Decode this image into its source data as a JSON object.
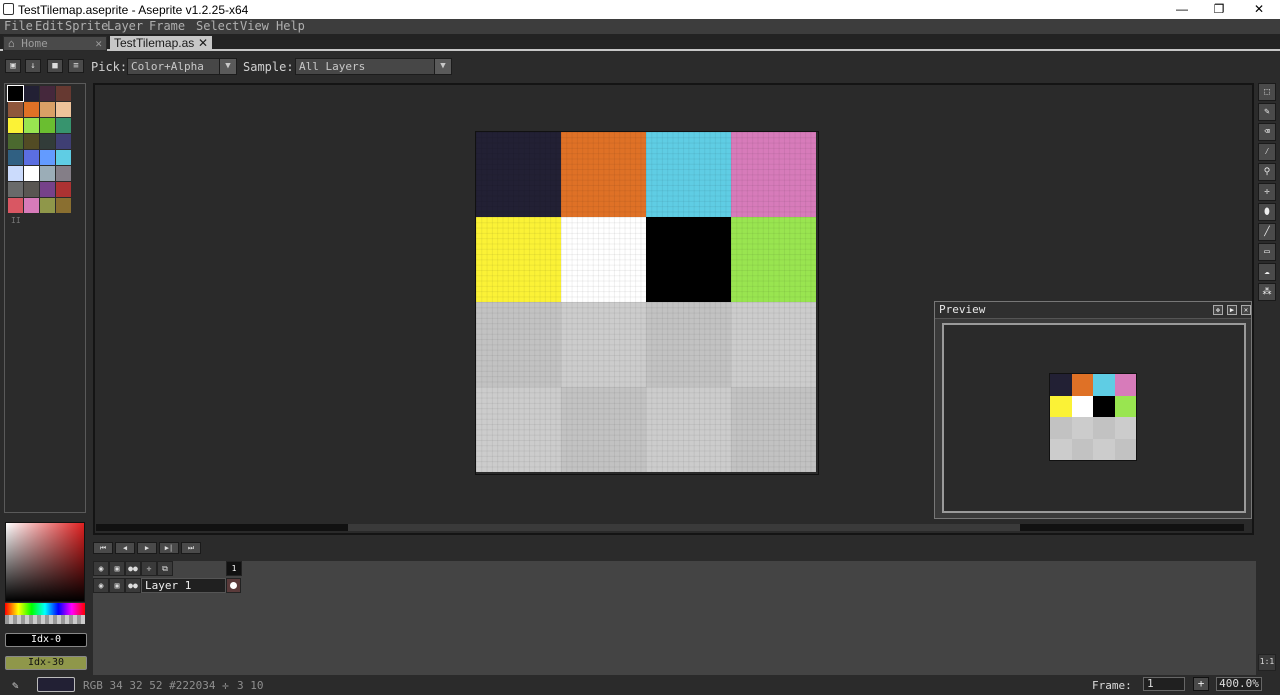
{
  "window": {
    "title": "TestTilemap.aseprite - Aseprite v1.2.25-x64",
    "min": "—",
    "max": "❐",
    "close": "✕"
  },
  "menu": [
    "File",
    "Edit",
    "Sprite",
    "Layer",
    "Frame",
    "Select",
    "View",
    "Help"
  ],
  "tabs": [
    {
      "label": "Home",
      "icon": "home-icon",
      "close": "✕"
    },
    {
      "label": "TestTilemap.as",
      "close": "✕"
    }
  ],
  "toolbar": {
    "pick_label": "Pick:",
    "pick_value": "Color+Alpha",
    "sample_label": "Sample:",
    "sample_value": "All Layers"
  },
  "palette": {
    "colors": [
      "#000000",
      "#222034",
      "#45283c",
      "#663931",
      "#8f563b",
      "#df7126",
      "#d9a066",
      "#eec39a",
      "#fbf236",
      "#99e550",
      "#6abe30",
      "#37946e",
      "#4b692f",
      "#524b24",
      "#323c39",
      "#3f3f74",
      "#306082",
      "#5b6ee1",
      "#639bff",
      "#5fcde4",
      "#cbdbfc",
      "#ffffff",
      "#9badb7",
      "#847e87",
      "#696a6a",
      "#595652",
      "#76428a",
      "#ac3232",
      "#d95763",
      "#d77bba",
      "#8f974a",
      "#8a6f30"
    ],
    "footer": "II"
  },
  "color_bar": {
    "fg_index": "Idx-0",
    "bg_index": "Idx-30"
  },
  "sprite": {
    "tiles": [
      "#222034",
      "#df7126",
      "#5fcde4",
      "#d77bba",
      "#fbf236",
      "#ffffff",
      "#000000",
      "#99e550",
      "#c2c2c2",
      "#cccccc",
      "#c2c2c2",
      "#cccccc",
      "#cccccc",
      "#c2c2c2",
      "#cccccc",
      "#c2c2c2"
    ]
  },
  "preview": {
    "title": "Preview"
  },
  "timeline": {
    "controls": [
      "⏮",
      "◀",
      "▶",
      "▶|",
      "⏭"
    ],
    "frame_number": "1",
    "layer_name": "Layer 1"
  },
  "status": {
    "color_text": "RGB 34 32 52 #222034",
    "position": "3 10",
    "frame_label": "Frame:",
    "frame_value": "1",
    "plus": "+",
    "zoom": "400.0%"
  },
  "colors": {
    "fg": "#222034",
    "bg_idx": "#8f974a"
  }
}
